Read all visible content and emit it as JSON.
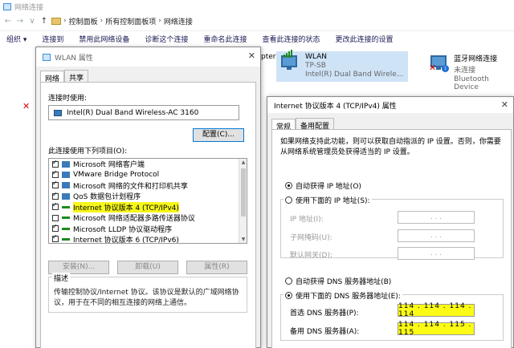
{
  "explorer": {
    "window_title": "网络连接",
    "breadcrumb": [
      "控制面板",
      "所有控制面板项",
      "网络连接"
    ],
    "toolbar": [
      "组织 ▾",
      "连接到",
      "禁用此网络设备",
      "诊断这个连接",
      "重命名此连接",
      "查看此连接的状态",
      "更改此连接的设置"
    ],
    "adapters": [
      {
        "name": "WLAN",
        "sub1": "TP-SB",
        "sub2": "Intel(R) Dual Band Wirele..."
      },
      {
        "name": "蓝牙网络连接",
        "sub1": "未连接",
        "sub2": "Bluetooth Device"
      }
    ],
    "partial_label": "pter"
  },
  "wlan_dialog": {
    "title": "WLAN 属性",
    "tabs": [
      "网络",
      "共享"
    ],
    "connect_using_label": "连接时使用:",
    "adapter_name": "Intel(R) Dual Band Wireless-AC 3160",
    "configure_button": "配置(C)...",
    "items_label": "此连接使用下列项目(O):",
    "items": [
      {
        "label": "Microsoft 网络客户端",
        "checked": true,
        "highlight": false
      },
      {
        "label": "VMware Bridge Protocol",
        "checked": true,
        "highlight": false
      },
      {
        "label": "Microsoft 网络的文件和打印机共享",
        "checked": true,
        "highlight": false
      },
      {
        "label": "QoS 数据包计划程序",
        "checked": true,
        "highlight": false
      },
      {
        "label": "Internet 协议版本 4 (TCP/IPv4)",
        "checked": true,
        "highlight": true
      },
      {
        "label": "Microsoft 网络适配器多路传送器协议",
        "checked": false,
        "highlight": false
      },
      {
        "label": "Microsoft LLDP 协议驱动程序",
        "checked": true,
        "highlight": false
      },
      {
        "label": "Internet 协议版本 6 (TCP/IPv6)",
        "checked": true,
        "highlight": false
      }
    ],
    "install_button": "安装(N)...",
    "uninstall_button": "卸载(U)",
    "properties_button": "属性(R)",
    "description_label": "描述",
    "description_text": "传输控制协议/Internet 协议。该协议是默认的广域网络协议，用于在不同的相互连接的网络上通信。"
  },
  "ipv4_dialog": {
    "title": "Internet 协议版本 4 (TCP/IPv4) 属性",
    "tabs": [
      "常规",
      "备用配置"
    ],
    "intro": "如果网络支持此功能，则可以获取自动指派的 IP 设置。否则，你需要从网络系统管理员处获得适当的 IP 设置。",
    "auto_ip_label": "自动获得 IP 地址(O)",
    "manual_ip_label": "使用下面的 IP 地址(S):",
    "ip_address_label": "IP 地址(I):",
    "subnet_label": "子网掩码(U):",
    "gateway_label": "默认网关(D):",
    "auto_dns_label": "自动获得 DNS 服务器地址(B)",
    "manual_dns_label": "使用下面的 DNS 服务器地址(E):",
    "preferred_dns_label": "首选 DNS 服务器(P):",
    "alternate_dns_label": "备用 DNS 服务器(A):",
    "preferred_dns": "114 . 114 . 114 . 114",
    "alternate_dns": "114 . 114 . 115 . 115",
    "empty_ip": ".     .     ."
  }
}
